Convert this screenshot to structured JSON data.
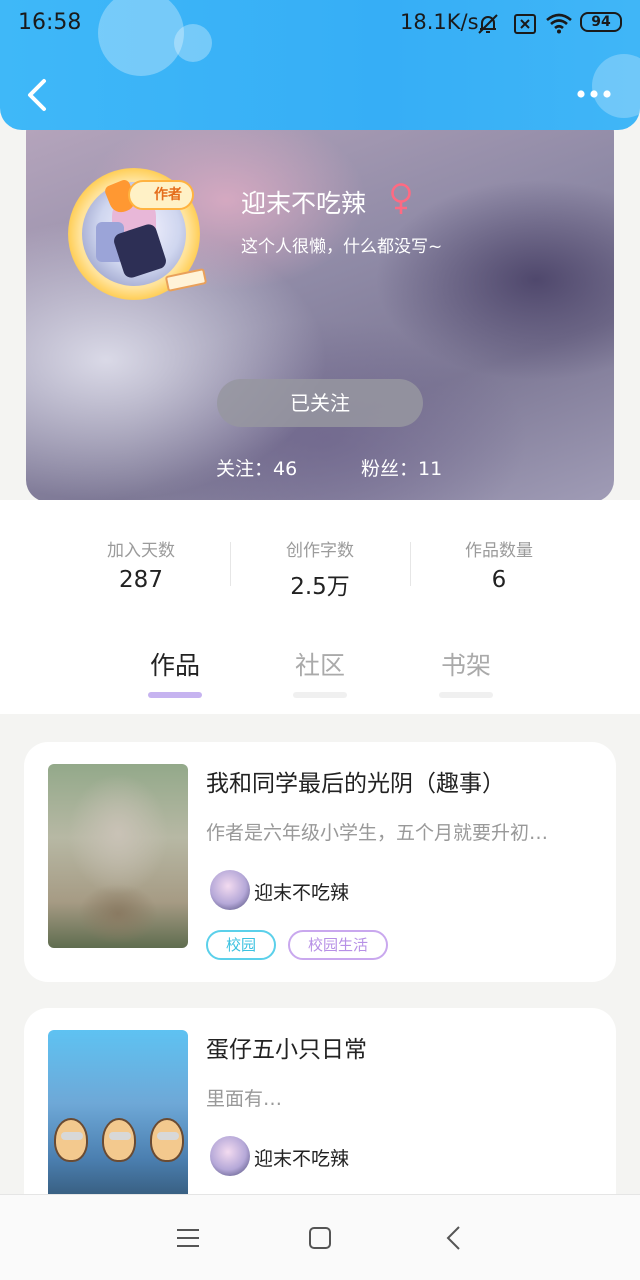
{
  "status_bar": {
    "time": "16:58",
    "net_speed": "18.1K/s",
    "battery": "94"
  },
  "profile": {
    "author_badge": "作者",
    "username": "迎末不吃辣",
    "gender": "female",
    "bio": "这个人很懒，什么都没写~",
    "follow_button": "已关注",
    "following": "关注：46",
    "fans": "粉丝：11"
  },
  "stats": [
    {
      "label": "加入天数",
      "value": "287"
    },
    {
      "label": "创作字数",
      "value": "2.5万"
    },
    {
      "label": "作品数量",
      "value": "6"
    }
  ],
  "tabs": [
    {
      "label": "作品",
      "active": true
    },
    {
      "label": "社区",
      "active": false
    },
    {
      "label": "书架",
      "active": false
    }
  ],
  "works": [
    {
      "title": "我和同学最后的光阴（趣事）",
      "description": "作者是六年级小学生，五个月就要升初…",
      "author": "迎末不吃辣",
      "tags": [
        "校园",
        "校园生活"
      ]
    },
    {
      "title": "蛋仔五小只日常",
      "description": "里面有…",
      "author": "迎末不吃辣",
      "tags": []
    }
  ],
  "colors": {
    "header": "#38b0f6",
    "accent_underline": "#c6b3f0",
    "tag_cyan": "#5bd0ea",
    "tag_purple": "#c9a8ee",
    "gender": "#ff6a82"
  },
  "icons": [
    "back-icon",
    "more-icon",
    "female-icon",
    "menu-icon",
    "home-icon",
    "nav-back-icon"
  ]
}
